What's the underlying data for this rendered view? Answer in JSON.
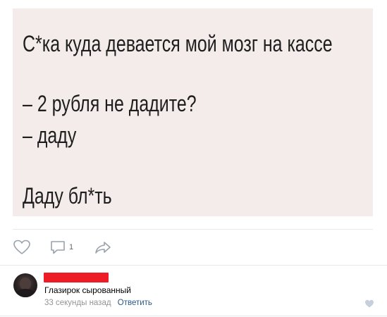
{
  "post": {
    "image_lines": [
      "С*ка куда девается мой мозг на кассе",
      "– 2 рубля не дадите?",
      "– даду",
      "Даду бл*ть"
    ]
  },
  "actions": {
    "like_icon": "heart-icon",
    "comment_icon": "comment-icon",
    "comment_count": "1",
    "share_icon": "share-arrow-icon"
  },
  "comment": {
    "author_redacted": true,
    "text": "Глазирок сырованный",
    "time": "33 секунды назад",
    "reply_label": "Ответить",
    "like_icon": "heart-icon"
  },
  "colors": {
    "image_background": "#f4ecea",
    "redaction": "#ee1c24",
    "link": "#2a5885",
    "muted": "#939393",
    "icon": "#99a2ad"
  }
}
